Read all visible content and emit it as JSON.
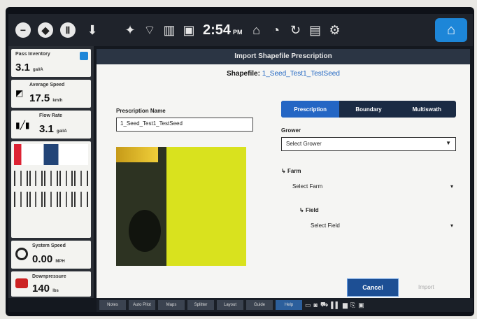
{
  "topbar": {
    "left_buttons": [
      "−",
      "◆",
      "Ⅱ"
    ],
    "clock": "2:54",
    "clock_suffix": "PM"
  },
  "left_panel": {
    "tile1": {
      "label": "Pass Inventory",
      "value": "3.1",
      "unit": "gal/A"
    },
    "tile2": {
      "label": "Average Speed",
      "value": "17.5",
      "unit": "km/h"
    },
    "tile3": {
      "label": "Flow Rate",
      "value": "3.1",
      "unit": "gal/A"
    },
    "tile4": {
      "label": "System Speed",
      "value": "0.00",
      "unit": "MPH"
    },
    "tile5": {
      "label": "Downpressure",
      "value": "140",
      "unit": "lbs"
    }
  },
  "dialog": {
    "title": "Import Shapefile Prescription",
    "shapefile_label": "Shapefile:",
    "shapefile_value": "1_Seed_Test1_TestSeed",
    "prescription_name_label": "Prescription Name",
    "prescription_name_value": "1_Seed_Test1_TestSeed",
    "tabs": [
      "Prescription",
      "Boundary",
      "Multiswath"
    ],
    "grower_label": "Grower",
    "grower_value": "Select Grower",
    "farm_label": "Farm",
    "farm_value": "Select Farm",
    "field_label": "Field",
    "field_value": "Select Field",
    "cancel_label": "Cancel",
    "import_label": "Import"
  },
  "bottom_bar": {
    "buttons": [
      "Notes",
      "Auto Pilot",
      "Maps",
      "Splitter",
      "Layout",
      "Guide",
      "Help"
    ]
  },
  "colors": {
    "accent": "#2466c4",
    "topbar": "#1f232b",
    "map_fill": "#d9e21e"
  }
}
